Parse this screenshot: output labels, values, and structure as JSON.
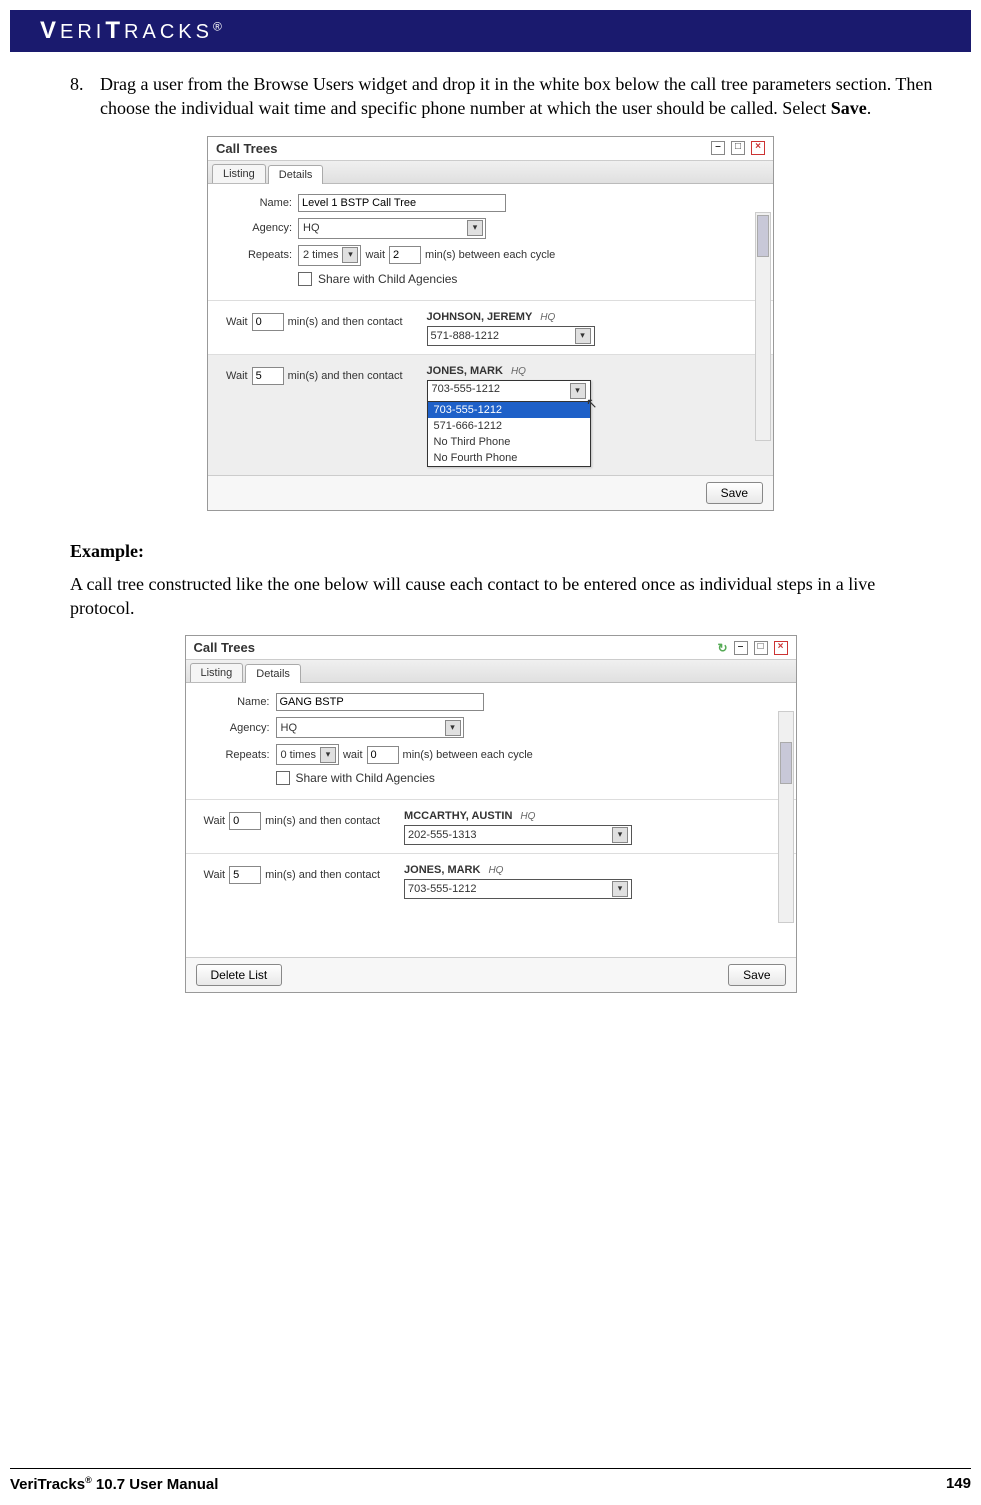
{
  "header": {
    "logo_text": "VERITRACKS",
    "reg": "®"
  },
  "step": {
    "number": "8.",
    "text_a": "Drag a user from the Browse Users widget and drop it in the white box below the call tree parameters section.  Then choose the individual wait time and specific phone number at which the user should be called.  Select ",
    "text_b_bold": "Save",
    "text_c": "."
  },
  "widget1": {
    "title": "Call Trees",
    "tabs": [
      "Listing",
      "Details"
    ],
    "active_tab": 1,
    "form": {
      "name_label": "Name:",
      "name_value": "Level 1 BSTP Call Tree",
      "agency_label": "Agency:",
      "agency_value": "HQ",
      "repeats_label": "Repeats:",
      "repeats_value": "2 times",
      "wait_label": "wait",
      "wait_value": "2",
      "wait_suffix": "min(s) between each cycle",
      "share_label": "Share with Child Agencies"
    },
    "contacts": [
      {
        "wait_label": "Wait",
        "wait_value": "0",
        "wait_suffix": "min(s) and then contact",
        "name": "JOHNSON, JEREMY",
        "org": "HQ",
        "phone": "571-888-1212"
      },
      {
        "wait_label": "Wait",
        "wait_value": "5",
        "wait_suffix": "min(s) and then contact",
        "name": "JONES, MARK",
        "org": "HQ",
        "phone_display": "703-555-1212",
        "options": [
          "703-555-1212",
          "571-666-1212",
          "No Third Phone",
          "No Fourth Phone"
        ],
        "selected_index": 0
      }
    ],
    "save_label": "Save"
  },
  "example_heading": "Example:",
  "example_text": "A call tree constructed like the one below will cause each contact to be entered once as individual steps in a live protocol.",
  "widget2": {
    "title": "Call Trees",
    "tabs": [
      "Listing",
      "Details"
    ],
    "active_tab": 1,
    "form": {
      "name_label": "Name:",
      "name_value": "GANG BSTP",
      "agency_label": "Agency:",
      "agency_value": "HQ",
      "repeats_label": "Repeats:",
      "repeats_value": "0 times",
      "wait_label": "wait",
      "wait_value": "0",
      "wait_suffix": "min(s) between each cycle",
      "share_label": "Share with Child Agencies"
    },
    "contacts": [
      {
        "wait_label": "Wait",
        "wait_value": "0",
        "wait_suffix": "min(s) and then contact",
        "name": "MCCARTHY, AUSTIN",
        "org": "HQ",
        "phone": "202-555-1313"
      },
      {
        "wait_label": "Wait",
        "wait_value": "5",
        "wait_suffix": "min(s) and then contact",
        "name": "JONES, MARK",
        "org": "HQ",
        "phone": "703-555-1212"
      }
    ],
    "delete_label": "Delete List",
    "save_label": "Save"
  },
  "footer": {
    "product": "VeriTracks",
    "reg": "®",
    "manual": " 10.7 User Manual",
    "page": "149"
  }
}
